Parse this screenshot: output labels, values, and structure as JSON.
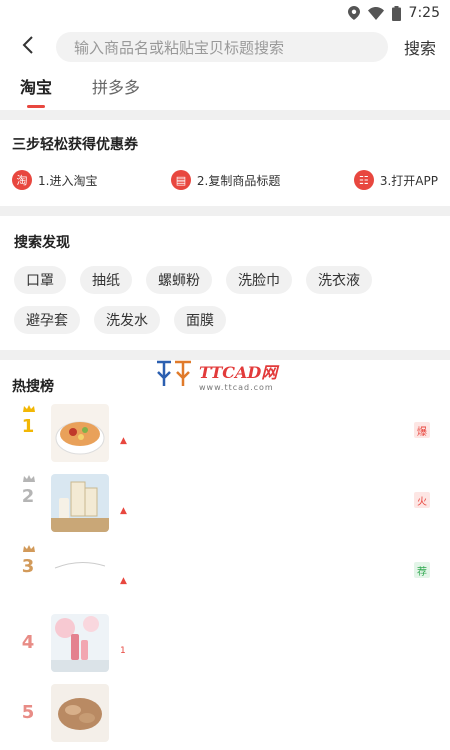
{
  "status": {
    "time": "7:25"
  },
  "search": {
    "placeholder": "输入商品名或粘贴宝贝标题搜索",
    "button": "搜索"
  },
  "tabs": [
    {
      "label": "淘宝",
      "active": true
    },
    {
      "label": "拼多多",
      "active": false
    }
  ],
  "steps": {
    "title": "三步轻松获得优惠券",
    "items": [
      {
        "icon": "taobao-icon",
        "glyph": "淘",
        "label": "1.进入淘宝"
      },
      {
        "icon": "copy-icon",
        "glyph": "▤",
        "label": "2.复制商品标题"
      },
      {
        "icon": "app-icon",
        "glyph": "☷",
        "label": "3.打开APP"
      }
    ]
  },
  "discover": {
    "title": "搜索发现",
    "chips": [
      "口罩",
      "抽纸",
      "螺蛳粉",
      "洗脸巾",
      "洗衣液",
      "避孕套",
      "洗发水",
      "面膜"
    ]
  },
  "hot": {
    "title": "热搜榜",
    "items": [
      {
        "rank": "1",
        "rank_color": "#f2b705",
        "crown_color": "#f2b705",
        "tag": "爆",
        "tag_color": "#e8473f",
        "tag_bg": "#fde6e4",
        "arrow": "▲",
        "thumb": "bowl"
      },
      {
        "rank": "2",
        "rank_color": "#b5b5b5",
        "crown_color": "#b5b5b5",
        "tag": "火",
        "tag_color": "#e8473f",
        "tag_bg": "#fde6e4",
        "arrow": "▲",
        "thumb": "milk"
      },
      {
        "rank": "3",
        "rank_color": "#d29a5a",
        "crown_color": "#d29a5a",
        "tag": "荐",
        "tag_color": "#2fa84f",
        "tag_bg": "#e3f5e8",
        "arrow": "▲",
        "thumb": "blank"
      },
      {
        "rank": "4",
        "rank_color": "#e88c86",
        "crown_color": "",
        "tag": "",
        "arrow": "1",
        "thumb": "pink"
      },
      {
        "rank": "5",
        "rank_color": "#e88c86",
        "crown_color": "",
        "tag": "",
        "arrow": "",
        "thumb": "food"
      }
    ]
  },
  "watermark": {
    "main": "TTCAD网",
    "sub": "www.ttcad.com"
  },
  "colors": {
    "accent": "#e8473f"
  }
}
